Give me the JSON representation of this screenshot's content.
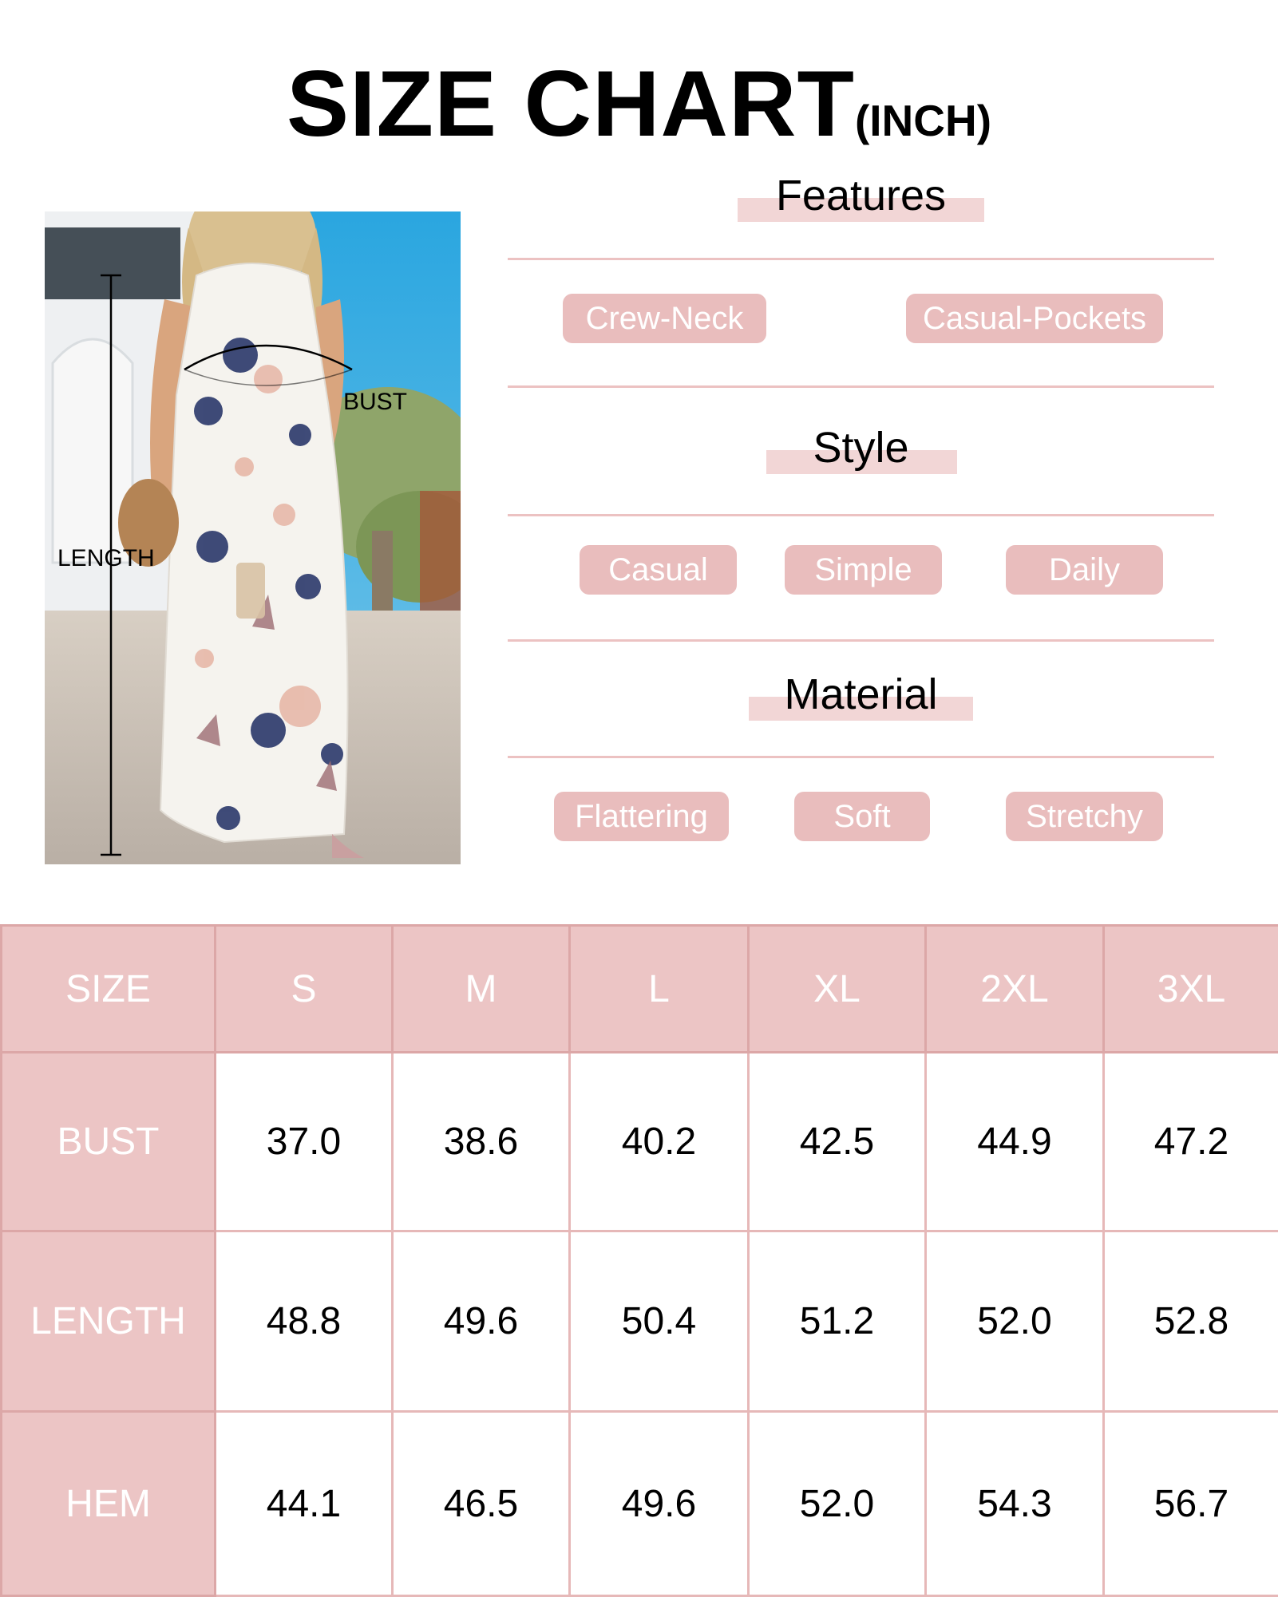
{
  "title": {
    "main": "SIZE CHART",
    "unit": "(INCH)"
  },
  "photo": {
    "bust_label": "BUST",
    "length_label": "LENGTH"
  },
  "features": {
    "heading": "Features",
    "tags": [
      "Crew-Neck",
      "Casual-Pockets"
    ]
  },
  "style": {
    "heading": "Style",
    "tags": [
      "Casual",
      "Simple",
      "Daily"
    ]
  },
  "material": {
    "heading": "Material",
    "tags": [
      "Flattering",
      "Soft",
      "Stretchy"
    ]
  },
  "colors": {
    "accent": "#ecc5c5",
    "tag_bg": "#e9bdbd",
    "highlight": "#f2d6d6"
  },
  "table": {
    "header": [
      "SIZE",
      "S",
      "M",
      "L",
      "XL",
      "2XL",
      "3XL"
    ],
    "rows": [
      {
        "label": "BUST",
        "values": [
          "37.0",
          "38.6",
          "40.2",
          "42.5",
          "44.9",
          "47.2"
        ]
      },
      {
        "label": "LENGTH",
        "values": [
          "48.8",
          "49.6",
          "50.4",
          "51.2",
          "52.0",
          "52.8"
        ]
      },
      {
        "label": "HEM",
        "values": [
          "44.1",
          "46.5",
          "49.6",
          "52.0",
          "54.3",
          "56.7"
        ]
      }
    ]
  }
}
